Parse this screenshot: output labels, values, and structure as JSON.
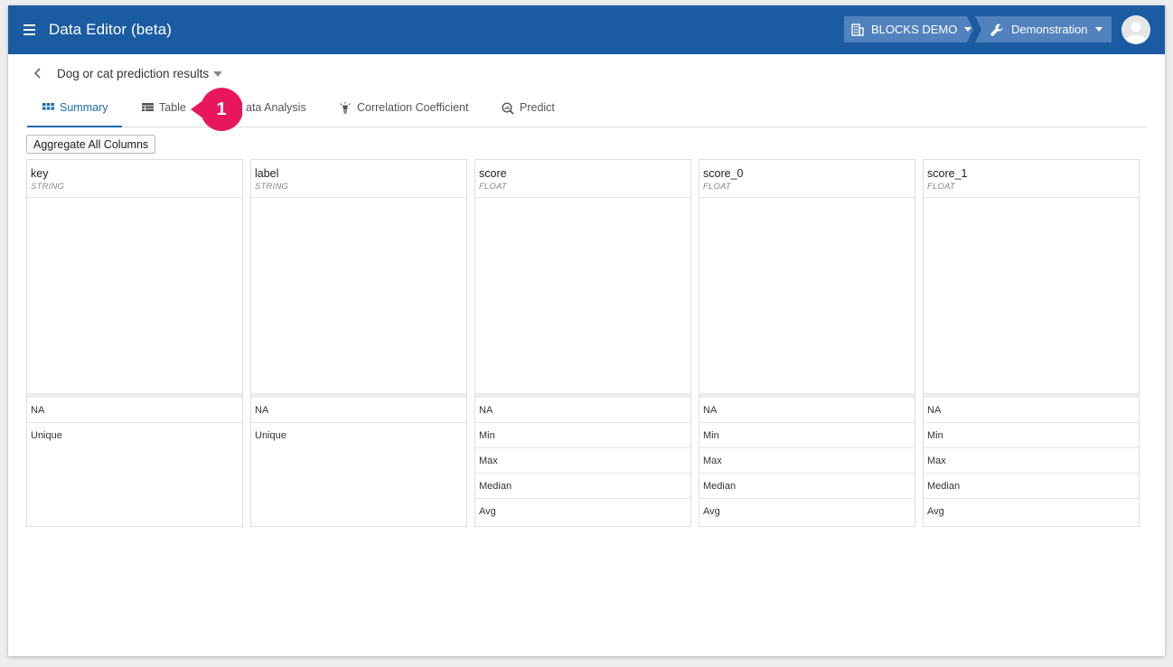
{
  "header": {
    "app_title": "Data Editor (beta)",
    "organization": "BLOCKS DEMO",
    "project": "Demonstration",
    "brand_color": "#1b5ba1"
  },
  "breadcrumb": {
    "dataset_name": "Dog or cat prediction results"
  },
  "tabs": [
    {
      "label": "Summary",
      "icon": "grid-icon",
      "active": true
    },
    {
      "label": "Table",
      "icon": "table-icon",
      "active": false
    },
    {
      "label": "ata Analysis",
      "icon": "analysis-icon",
      "active": false
    },
    {
      "label": "Correlation Coefficient",
      "icon": "lightbulb-icon",
      "active": false
    },
    {
      "label": "Predict",
      "icon": "magnify-chart-icon",
      "active": false
    }
  ],
  "callout": {
    "number": "1",
    "color": "#e8175d"
  },
  "toolbar": {
    "aggregate_label": "Aggregate All Columns"
  },
  "columns": [
    {
      "name": "key",
      "type": "STRING",
      "stats": [
        "NA",
        "Unique"
      ]
    },
    {
      "name": "label",
      "type": "STRING",
      "stats": [
        "NA",
        "Unique"
      ]
    },
    {
      "name": "score",
      "type": "FLOAT",
      "stats": [
        "NA",
        "Min",
        "Max",
        "Median",
        "Avg"
      ]
    },
    {
      "name": "score_0",
      "type": "FLOAT",
      "stats": [
        "NA",
        "Min",
        "Max",
        "Median",
        "Avg"
      ]
    },
    {
      "name": "score_1",
      "type": "FLOAT",
      "stats": [
        "NA",
        "Min",
        "Max",
        "Median",
        "Avg"
      ]
    }
  ]
}
